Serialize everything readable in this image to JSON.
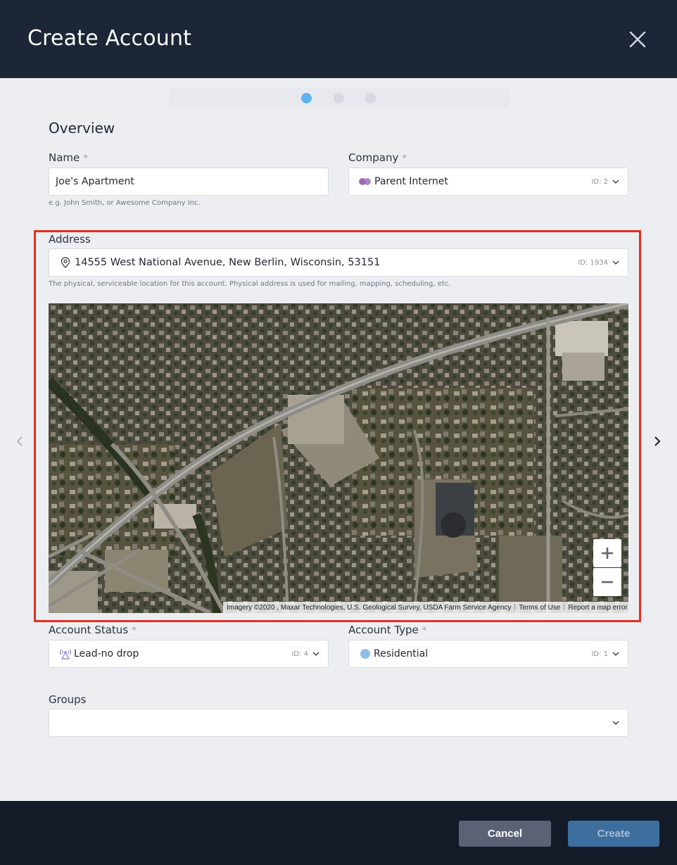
{
  "header": {
    "title": "Create Account"
  },
  "section": {
    "title": "Overview"
  },
  "name": {
    "label": "Name",
    "required": "*",
    "value": "Joe's Apartment",
    "help": "e.g. John Smith, or Awesome Company Inc."
  },
  "company": {
    "label": "Company",
    "required": "*",
    "value": "Parent Internet",
    "id": "ID: 2",
    "color": "#9b6bb5"
  },
  "address": {
    "label": "Address",
    "value": "14555 West National Avenue, New Berlin, Wisconsin, 53151",
    "id": "ID: 1934",
    "help": "The physical, serviceable location for this account. Physical address is used for mailing, mapping, scheduling, etc."
  },
  "map": {
    "attribution": "Imagery ©2020 , Maxar Technologies, U.S. Geological Survey, USDA Farm Service Agency",
    "terms": "Terms of Use",
    "report": "Report a map error"
  },
  "account_status": {
    "label": "Account Status",
    "required": "*",
    "value": "Lead-no drop",
    "id": "ID: 4",
    "icon": "antenna-icon",
    "color": "#8b7fd4"
  },
  "account_type": {
    "label": "Account Type",
    "required": "*",
    "value": "Residential",
    "id": "ID: 1",
    "color": "#8fbfe8"
  },
  "groups": {
    "label": "Groups",
    "value": ""
  },
  "footer": {
    "cancel": "Cancel",
    "create": "Create"
  },
  "colors": {
    "header_bg": "#1c2636",
    "footer_bg": "#131b29",
    "accent": "#5db4ef",
    "highlight": "#e3301e"
  }
}
